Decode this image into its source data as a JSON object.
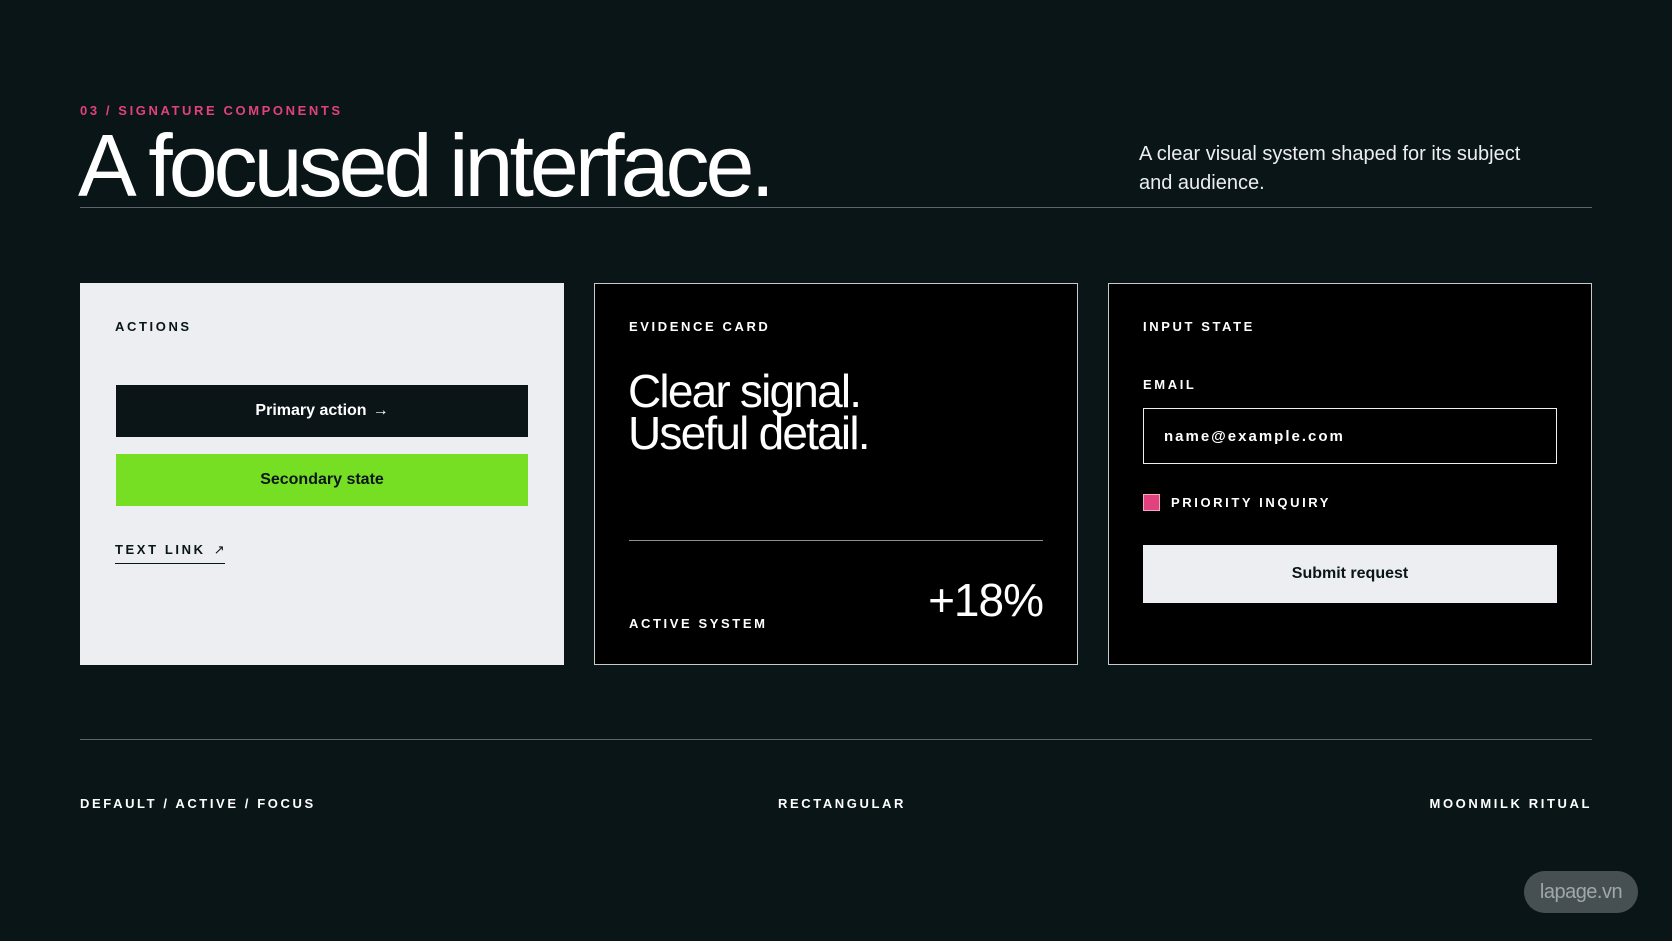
{
  "header": {
    "eyebrow": "03 / SIGNATURE COMPONENTS",
    "title": "A focused interface.",
    "description": "A clear visual system shaped for its subject and audience."
  },
  "cards": {
    "actions": {
      "label": "ACTIONS",
      "primary_button": "Primary action",
      "primary_arrow": "→",
      "secondary_button": "Secondary state",
      "text_link": "TEXT LINK",
      "text_link_arrow": "↗"
    },
    "evidence": {
      "label": "EVIDENCE CARD",
      "headline_line1": "Clear signal.",
      "headline_line2": "Useful detail.",
      "status": "ACTIVE SYSTEM",
      "metric": "+18%"
    },
    "input": {
      "label": "INPUT STATE",
      "email_label": "EMAIL",
      "email_placeholder": "name@example.com",
      "checkbox_label": "PRIORITY INQUIRY",
      "checkbox_checked": true,
      "submit_button": "Submit request"
    }
  },
  "footer": {
    "left": "DEFAULT / ACTIVE / FOCUS",
    "center": "RECTANGULAR",
    "right": "MOONMILK RITUAL"
  },
  "watermark": "lapage.vn",
  "colors": {
    "background": "#0a1517",
    "accent_pink": "#e2417f",
    "accent_green": "#76df23",
    "light": "#eceef1",
    "card_dark": "#000000"
  },
  "icons": {
    "primary_arrow": "arrow-right-icon",
    "text_link_arrow": "arrow-up-right-icon"
  }
}
